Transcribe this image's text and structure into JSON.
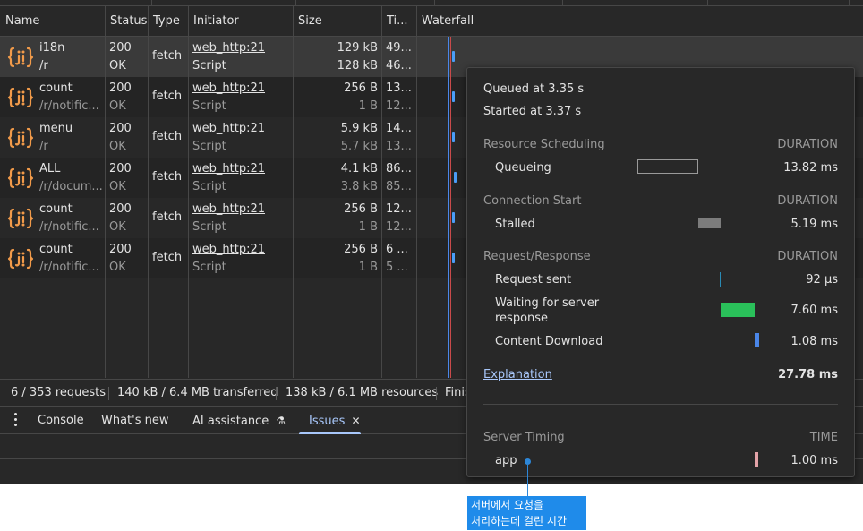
{
  "columns": {
    "name": "Name",
    "status": "Status",
    "type": "Type",
    "initiator": "Initiator",
    "size": "Size",
    "time": "Ti...",
    "waterfall": "Waterfall"
  },
  "requests": [
    {
      "name": "i18n",
      "path": "/r",
      "status": "200",
      "status_text": "OK",
      "type": "fetch",
      "initiator": "web_http:21",
      "initiator_type": "Script",
      "size": "129 kB",
      "resource_size": "128 kB",
      "time": "49...",
      "latency": "46..."
    },
    {
      "name": "count",
      "path": "/r/notific...",
      "status": "200",
      "status_text": "OK",
      "type": "fetch",
      "initiator": "web_http:21",
      "initiator_type": "Script",
      "size": "256 B",
      "resource_size": "1 B",
      "time": "13...",
      "latency": "12..."
    },
    {
      "name": "menu",
      "path": "/r",
      "status": "200",
      "status_text": "OK",
      "type": "fetch",
      "initiator": "web_http:21",
      "initiator_type": "Script",
      "size": "5.9 kB",
      "resource_size": "5.7 kB",
      "time": "14...",
      "latency": "13..."
    },
    {
      "name": "ALL",
      "path": "/r/docum...",
      "status": "200",
      "status_text": "OK",
      "type": "fetch",
      "initiator": "web_http:21",
      "initiator_type": "Script",
      "size": "4.1 kB",
      "resource_size": "3.8 kB",
      "time": "86...",
      "latency": "85..."
    },
    {
      "name": "count",
      "path": "/r/notific...",
      "status": "200",
      "status_text": "OK",
      "type": "fetch",
      "initiator": "web_http:21",
      "initiator_type": "Script",
      "size": "256 B",
      "resource_size": "1 B",
      "time": "12...",
      "latency": "12..."
    },
    {
      "name": "count",
      "path": "/r/notific...",
      "status": "200",
      "status_text": "OK",
      "type": "fetch",
      "initiator": "web_http:21",
      "initiator_type": "Script",
      "size": "256 B",
      "resource_size": "1 B",
      "time": "6 ...",
      "latency": "5 ..."
    }
  ],
  "summary": {
    "requests": "6 / 353 requests",
    "transferred": "140 kB / 6.4 MB transferred",
    "resources": "138 kB / 6.1 MB resources",
    "finish": "Finis"
  },
  "drawer": {
    "tabs": [
      "Console",
      "What's new",
      "AI assistance",
      "Issues"
    ],
    "active_tab": "Issues",
    "close_glyph": "✕",
    "flask_glyph": "⚗"
  },
  "timing": {
    "queued": "Queued at 3.35 s",
    "started": "Started at 3.37 s",
    "duration_label": "DURATION",
    "time_label": "TIME",
    "sections": {
      "scheduling": "Resource Scheduling",
      "connection": "Connection Start",
      "request": "Request/Response",
      "server": "Server Timing"
    },
    "queueing": {
      "label": "Queueing",
      "value": "13.82 ms"
    },
    "stalled": {
      "label": "Stalled",
      "value": "5.19 ms"
    },
    "request_sent": {
      "label": "Request sent",
      "value": "92 µs"
    },
    "waiting_1": "Waiting for server",
    "waiting_2": "response",
    "waiting_value": "7.60 ms",
    "content_download": {
      "label": "Content Download",
      "value": "1.08 ms"
    },
    "explanation": "Explanation",
    "total": "27.78 ms",
    "server_app": {
      "label": "app",
      "value": "1.00 ms"
    },
    "colors": {
      "stalled": "#7c7c7c",
      "request_sent": "#2a8bb5",
      "waiting": "#2ac05a",
      "download": "#4a86e8",
      "server": "#e3a3a8"
    }
  },
  "annotation": {
    "line1": "서버에서 요청을",
    "line2": "처리하는데 걸린 시간",
    "color": "#1f8bea"
  }
}
